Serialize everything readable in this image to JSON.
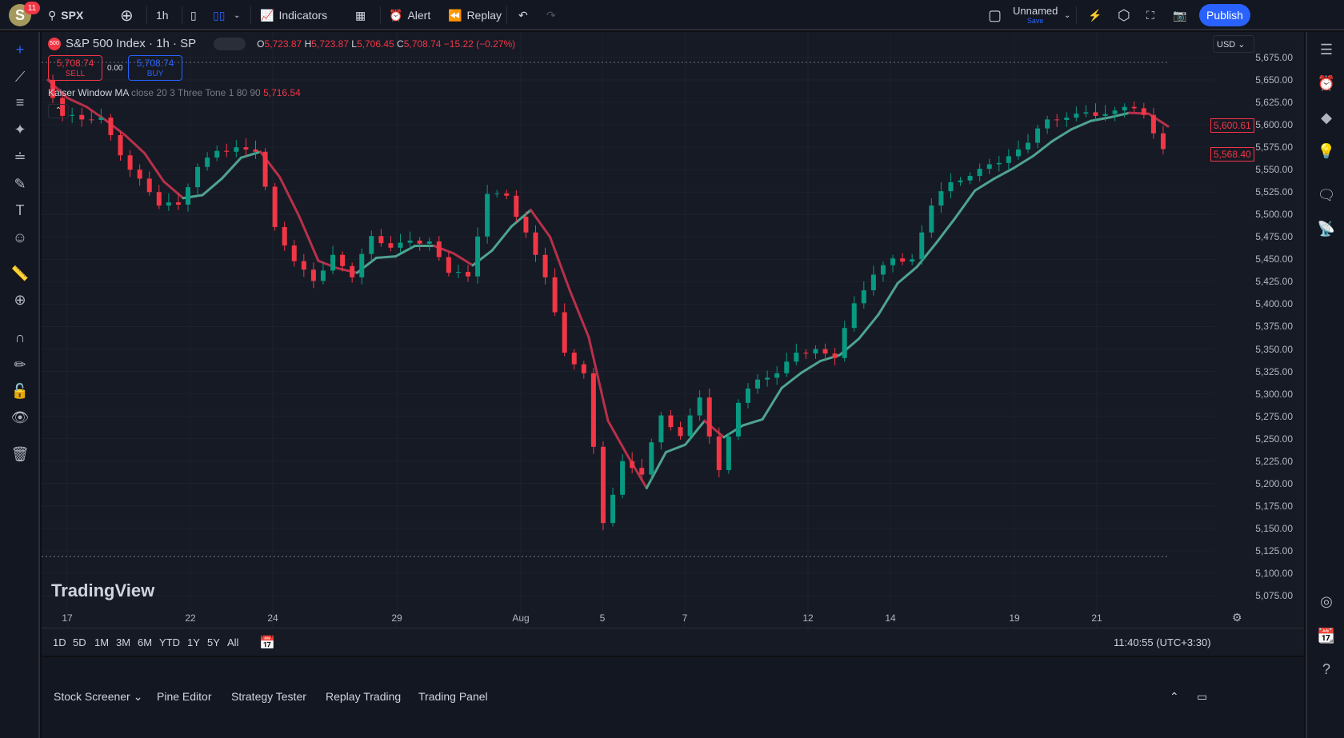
{
  "header": {
    "notifications": "11",
    "avatar_letter": "S",
    "symbol": "SPX",
    "interval": "1h",
    "indicators": "Indicators",
    "alert": "Alert",
    "replay": "Replay",
    "layout_name": "Unnamed",
    "save": "Save",
    "publish": "Publish"
  },
  "legend": {
    "title": "S&P 500 Index · 1h · SP",
    "exchange_badge": "500",
    "o_label": "O",
    "o": "5,723.87",
    "h_label": "H",
    "h": "5,723.87",
    "l_label": "L",
    "l": "5,706.45",
    "c_label": "C",
    "c": "5,708.74",
    "change": "−15.22 (−0.27%)",
    "sell_price": "5,708.74",
    "sell": "SELL",
    "spread": "0.00",
    "buy_price": "5,708.74",
    "buy": "BUY",
    "indicator_name": "Kaiser Window MA",
    "indicator_params": "close 20 3 Three Tone 1 80 90",
    "indicator_value": "5,716.54"
  },
  "currency": "USD",
  "price_labels": [
    "5,675.00",
    "5,650.00",
    "5,625.00",
    "5,600.00",
    "5,575.00",
    "5,550.00",
    "5,525.00",
    "5,500.00",
    "5,475.00",
    "5,450.00",
    "5,425.00",
    "5,400.00",
    "5,375.00",
    "5,350.00",
    "5,325.00",
    "5,300.00",
    "5,275.00",
    "5,250.00",
    "5,225.00",
    "5,200.00",
    "5,175.00",
    "5,150.00",
    "5,125.00",
    "5,100.00",
    "5,075.00"
  ],
  "price_tags": {
    "ma": "5,600.61",
    "last": "5,568.40"
  },
  "date_labels": [
    "17",
    "22",
    "24",
    "29",
    "Aug",
    "5",
    "7",
    "12",
    "14",
    "19",
    "21"
  ],
  "watermark": "TradingView",
  "ranges": [
    "1D",
    "5D",
    "1M",
    "3M",
    "6M",
    "YTD",
    "1Y",
    "5Y",
    "All"
  ],
  "clock": "11:40:55 (UTC+3:30)",
  "bottom_tabs": [
    "Stock Screener",
    "Pine Editor",
    "Strategy Tester",
    "Replay Trading",
    "Trading Panel"
  ],
  "colors": {
    "up": "#089981",
    "down": "#f23645",
    "accent": "#2962ff"
  },
  "chart_data": {
    "type": "candlestick",
    "ylim": [
      5075,
      5675
    ],
    "closes": [
      5650,
      5610,
      5600,
      5605,
      5560,
      5540,
      5510,
      5505,
      5550,
      5565,
      5575,
      5570,
      5480,
      5445,
      5420,
      5455,
      5430,
      5470,
      5460,
      5465,
      5470,
      5435,
      5425,
      5520,
      5515,
      5480,
      5430,
      5340,
      5320,
      5150,
      5225,
      5210,
      5270,
      5250,
      5290,
      5215,
      5290,
      5310,
      5320,
      5340,
      5350,
      5340,
      5395,
      5430,
      5445,
      5450,
      5510,
      5530,
      5540,
      5550,
      5565,
      5580,
      5600,
      5605,
      5608,
      5612,
      5620,
      5605,
      5570
    ]
  }
}
